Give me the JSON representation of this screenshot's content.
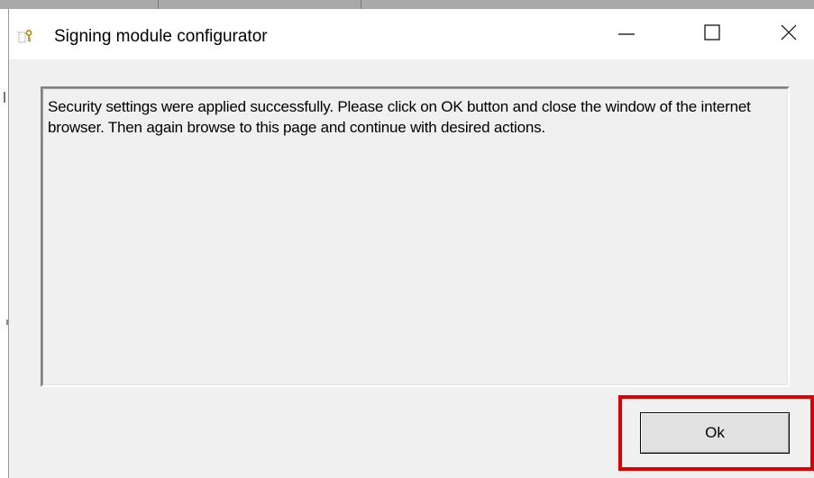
{
  "window": {
    "title": "Signing module configurator",
    "icon": "key-icon"
  },
  "titlebar_buttons": {
    "minimize": "minimize-icon",
    "maximize": "maximize-icon",
    "close": "close-icon"
  },
  "message": {
    "text": "Security settings were applied successfully. Please click on OK button and close the window of the internet browser. Then again browse to this page and continue with desired actions."
  },
  "actions": {
    "ok_label": "Ok"
  },
  "colors": {
    "highlight": "#e00000",
    "dialog_bg": "#f0f0f0",
    "titlebar_bg": "#ffffff"
  }
}
